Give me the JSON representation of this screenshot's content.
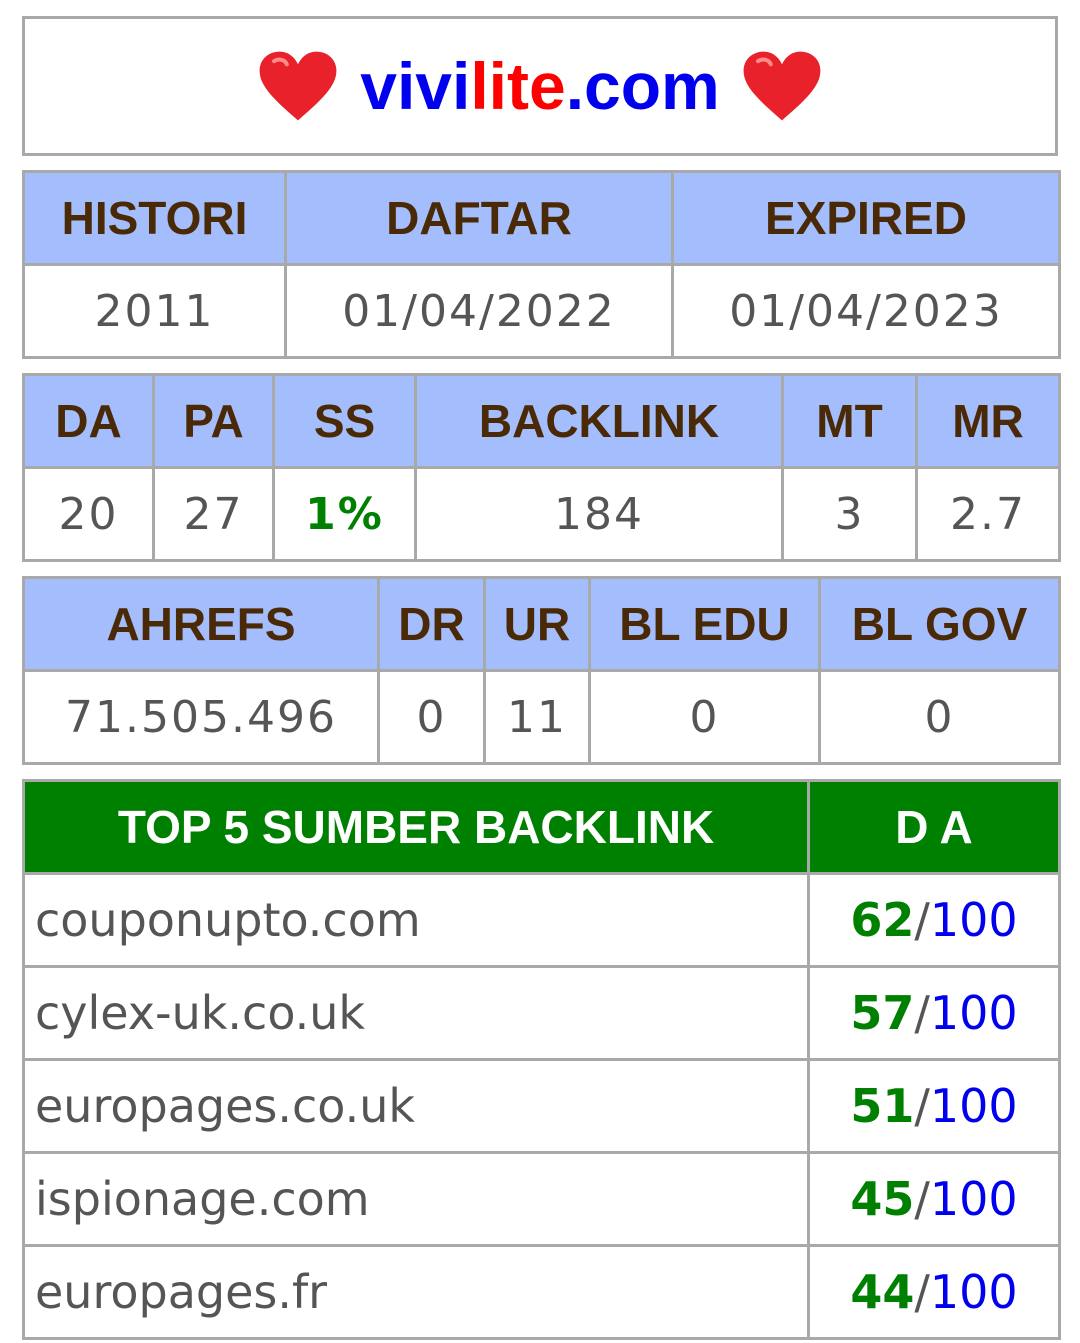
{
  "site": {
    "prefix": "vivi",
    "highlight": "lite",
    "suffix": ".com"
  },
  "registration": {
    "headers": [
      "HISTORI",
      "DAFTAR",
      "EXPIRED"
    ],
    "values": [
      "2011",
      "01/04/2022",
      "01/04/2023"
    ]
  },
  "moz": {
    "headers": [
      "DA",
      "PA",
      "SS",
      "BACKLINK",
      "MT",
      "MR"
    ],
    "values": [
      "20",
      "27",
      "1%",
      "184",
      "3",
      "2.7"
    ]
  },
  "ahrefs": {
    "headers": [
      "AHREFS",
      "DR",
      "UR",
      "BL EDU",
      "BL GOV"
    ],
    "values": [
      "71.505.496",
      "0",
      "11",
      "0",
      "0"
    ]
  },
  "top_backlinks": {
    "header_source": "TOP 5 SUMBER BACKLINK",
    "header_da": "D A",
    "rows": [
      {
        "domain": "couponupto.com",
        "score": "62",
        "sep": "/",
        "max": "100"
      },
      {
        "domain": "cylex-uk.co.uk",
        "score": "57",
        "sep": "/",
        "max": "100"
      },
      {
        "domain": "europages.co.uk",
        "score": "51",
        "sep": "/",
        "max": "100"
      },
      {
        "domain": "ispionage.com",
        "score": "45",
        "sep": "/",
        "max": "100"
      },
      {
        "domain": "europages.fr",
        "score": "44",
        "sep": "/",
        "max": "100"
      }
    ]
  },
  "colors": {
    "header_blue": "#a4bdfc",
    "header_green": "#008000",
    "brand_blue": "#0000ee",
    "brand_red": "#ff0000"
  },
  "icons": [
    "heart-icon"
  ]
}
